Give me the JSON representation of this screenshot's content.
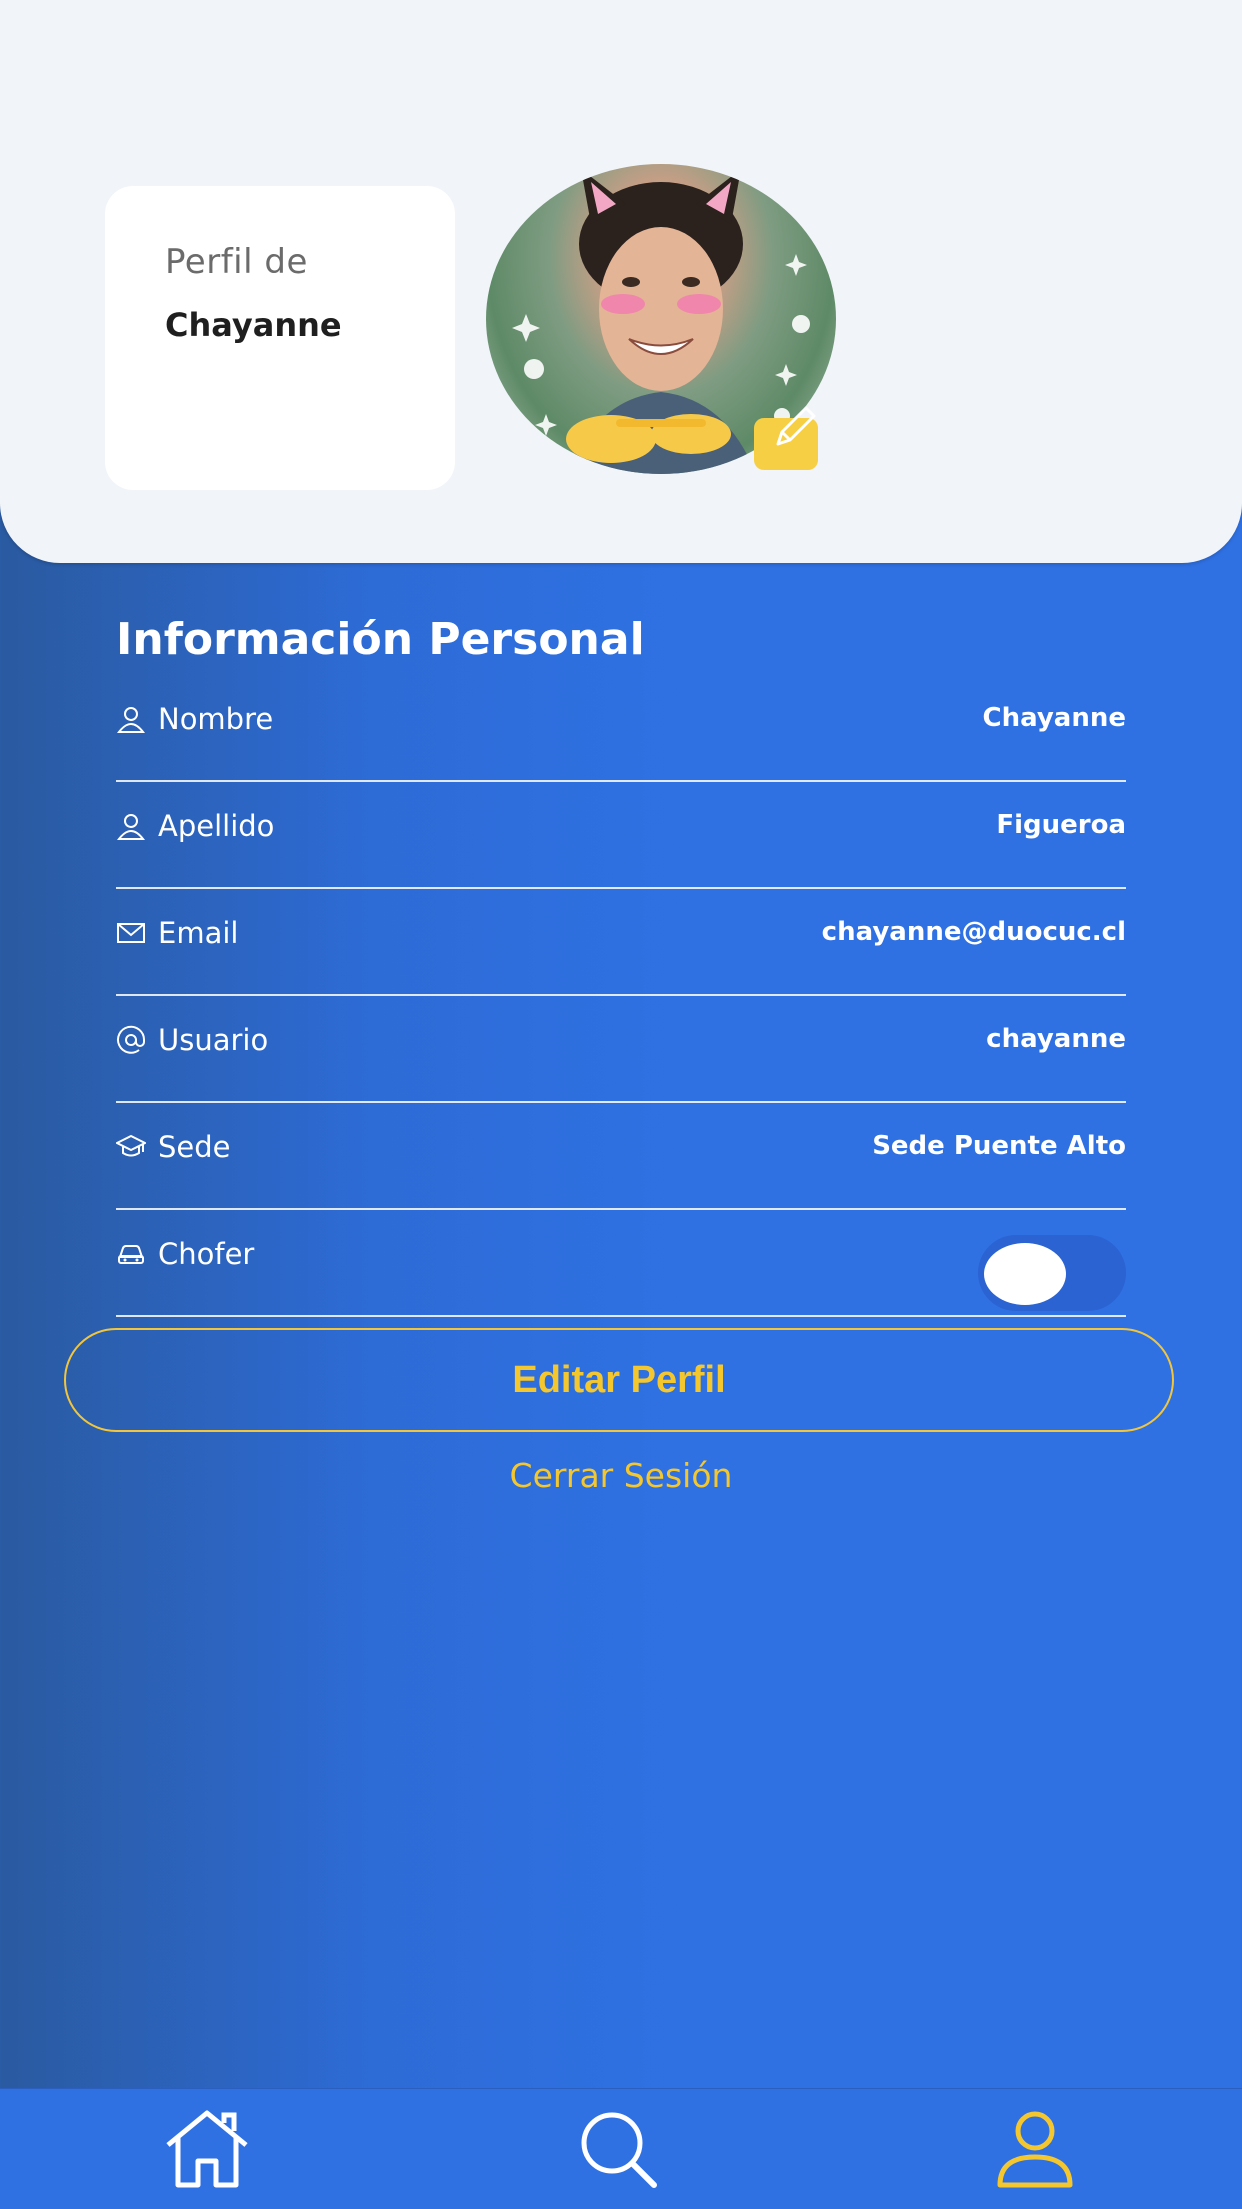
{
  "header": {
    "profile_label": "Perfil de",
    "profile_name": "Chayanne"
  },
  "personal_info": {
    "title": "Información Personal",
    "rows": [
      {
        "label": "Nombre",
        "value": "Chayanne",
        "icon": "user-icon"
      },
      {
        "label": "Apellido",
        "value": "Figueroa",
        "icon": "user-icon"
      },
      {
        "label": "Email",
        "value": "chayanne@duocuc.cl",
        "icon": "mail-icon"
      },
      {
        "label": "Usuario",
        "value": "chayanne",
        "icon": "at-icon"
      },
      {
        "label": "Sede",
        "value": "Sede Puente Alto",
        "icon": "graduation-cap-icon"
      },
      {
        "label": "Chofer",
        "toggle_on": false,
        "icon": "car-icon"
      }
    ]
  },
  "actions": {
    "edit_label": "Editar Perfil",
    "logout_label": "Cerrar Sesión"
  },
  "nav": {
    "items": [
      "home-icon",
      "search-icon",
      "profile-icon"
    ],
    "active": "profile-icon"
  },
  "colors": {
    "primary": "#2f71e3",
    "accent": "#f4c72e",
    "background_top": "#f1f4f8"
  }
}
